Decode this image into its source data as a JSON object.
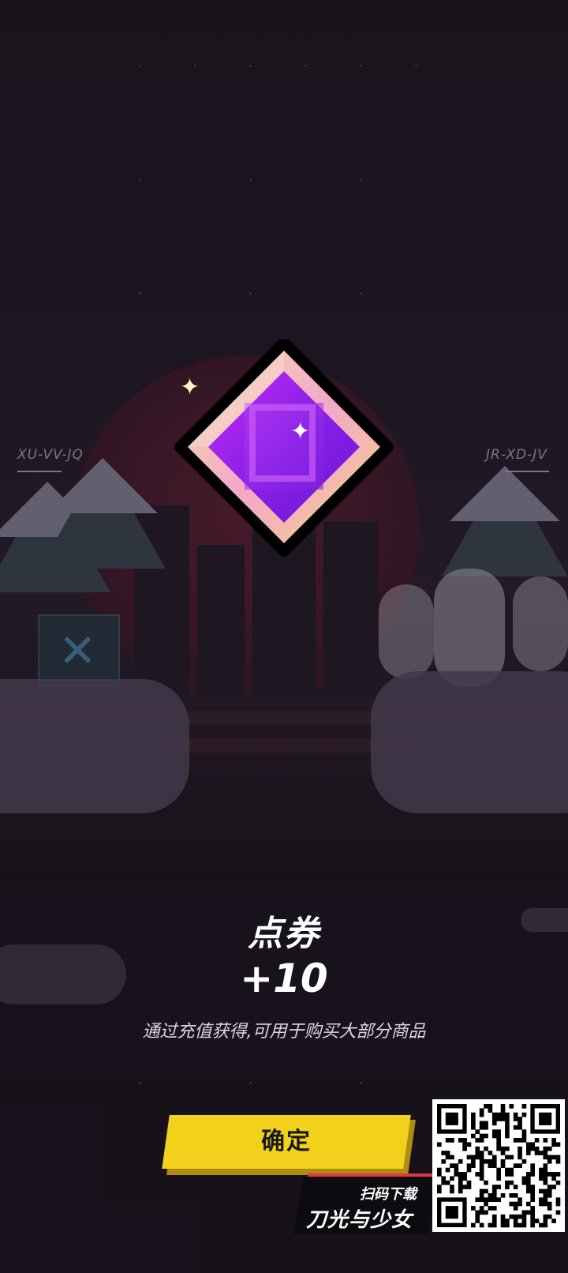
{
  "scene": {
    "left_code": "XU-VV-JQ",
    "right_code": "JR-XD-JV"
  },
  "reward": {
    "title": "点券",
    "amount": "+10",
    "description": "通过充值获得,可用于购买大部分商品",
    "icon": "diamond-gem-icon"
  },
  "actions": {
    "confirm_label": "确定"
  },
  "promo": {
    "scan_text": "扫码下载",
    "game_name": "刀光与少女",
    "qr_icon": "qr-code-icon"
  },
  "colors": {
    "button": "#f1d11c",
    "accent_red": "#e0364a",
    "gem_purple": "#a21ff0",
    "gem_border": "#f4d6a0"
  }
}
